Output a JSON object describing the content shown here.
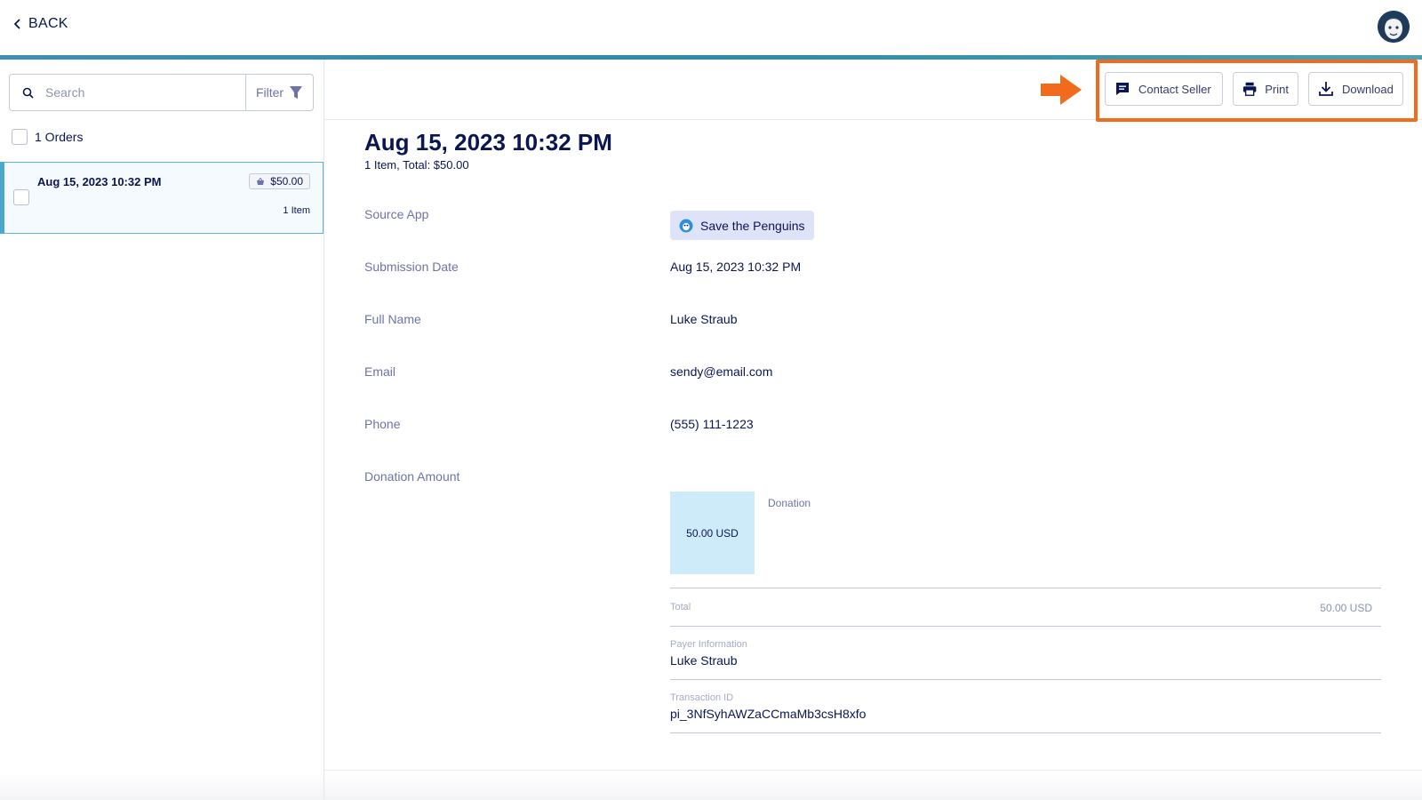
{
  "topbar": {
    "back_label": "BACK"
  },
  "sidebar": {
    "search_placeholder": "Search",
    "filter_label": "Filter",
    "orders_count_label": "1 Orders",
    "order": {
      "date": "Aug 15, 2023 10:32 PM",
      "price": "$50.00",
      "items": "1 Item"
    }
  },
  "toolbar": {
    "contact_label": "Contact Seller",
    "print_label": "Print",
    "download_label": "Download"
  },
  "detail": {
    "title": "Aug 15, 2023 10:32 PM",
    "subtitle": "1 Item, Total: $50.00",
    "fields": {
      "source_app_label": "Source App",
      "source_app_value": "Save the Penguins",
      "submission_date_label": "Submission Date",
      "submission_date_value": "Aug 15, 2023 10:32 PM",
      "full_name_label": "Full Name",
      "full_name_value": "Luke Straub",
      "email_label": "Email",
      "email_value": "sendy@email.com",
      "phone_label": "Phone",
      "phone_value": "(555) 111-1223",
      "donation_amount_label": "Donation Amount"
    },
    "donation": {
      "amount": "50.00 USD",
      "name": "Donation",
      "total_label": "Total",
      "total_value": "50.00 USD",
      "payer_label": "Payer Information",
      "payer_value": "Luke Straub",
      "transaction_label": "Transaction ID",
      "transaction_value": "pi_3NfSyhAWZaCCmaMb3csH8xfo"
    }
  },
  "colors": {
    "highlight": "#f26b1d",
    "accent": "#4aa8cc",
    "navy": "#0a1551"
  }
}
